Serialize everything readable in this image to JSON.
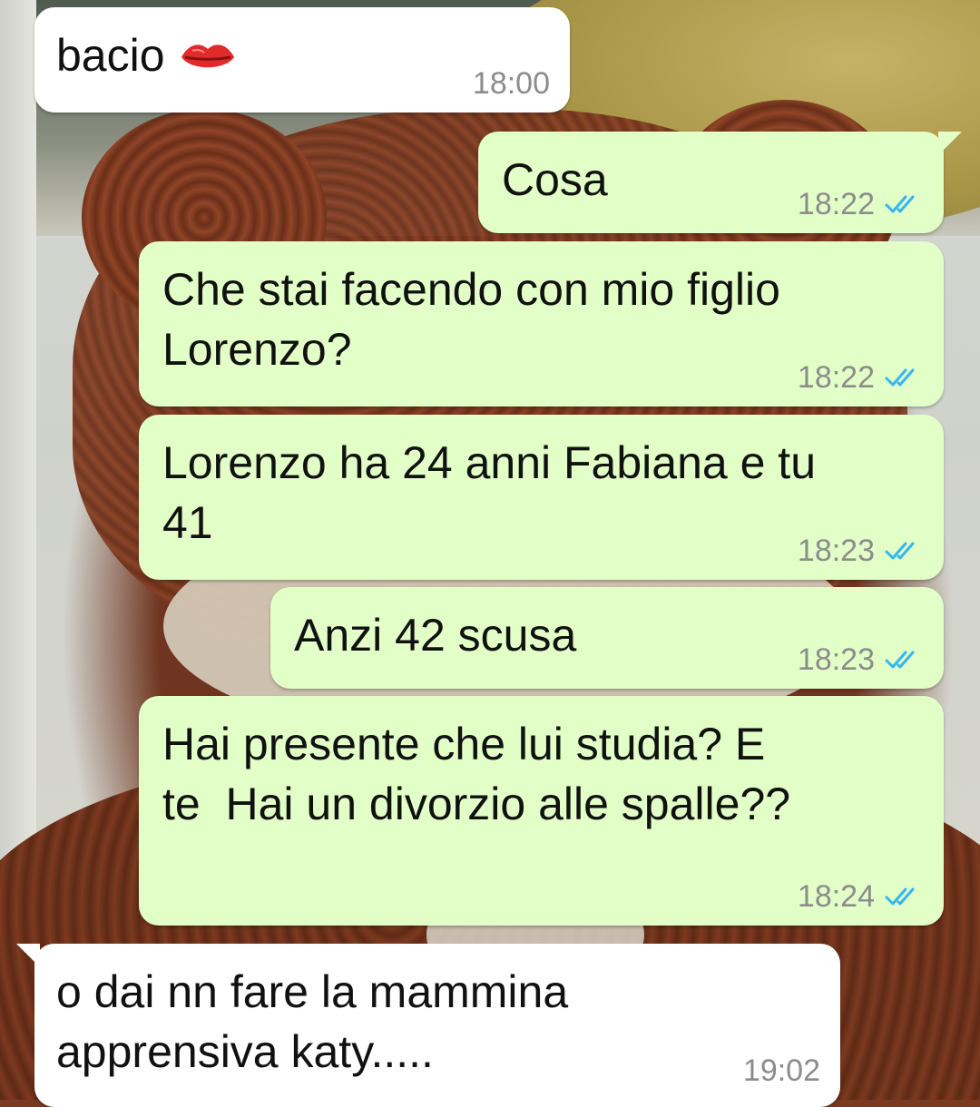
{
  "messages": [
    {
      "direction": "incoming",
      "text": "bacio",
      "emoji": "kiss-lips-icon",
      "time": "18:00"
    },
    {
      "direction": "outgoing",
      "text": "Cosa",
      "time": "18:22",
      "status": "read"
    },
    {
      "direction": "outgoing",
      "text": "Che stai facendo con mio figlio\nLorenzo?",
      "time": "18:22",
      "status": "read"
    },
    {
      "direction": "outgoing",
      "text": "Lorenzo ha 24 anni Fabiana e tu\n41",
      "time": "18:23",
      "status": "read"
    },
    {
      "direction": "outgoing",
      "text": "Anzi 42 scusa",
      "time": "18:23",
      "status": "read"
    },
    {
      "direction": "outgoing",
      "text": "Hai presente che lui studia? E\nte  Hai un divorzio alle spalle??",
      "time": "18:24",
      "status": "read"
    },
    {
      "direction": "incoming",
      "text": "o dai nn fare la mammina\napprensiva katy.....",
      "time": "19:02"
    }
  ],
  "colors": {
    "outgoing_bubble": "#e2ffc7",
    "incoming_bubble": "#ffffff",
    "read_ticks": "#34b7f1",
    "timestamp": "#8c8c8c"
  }
}
